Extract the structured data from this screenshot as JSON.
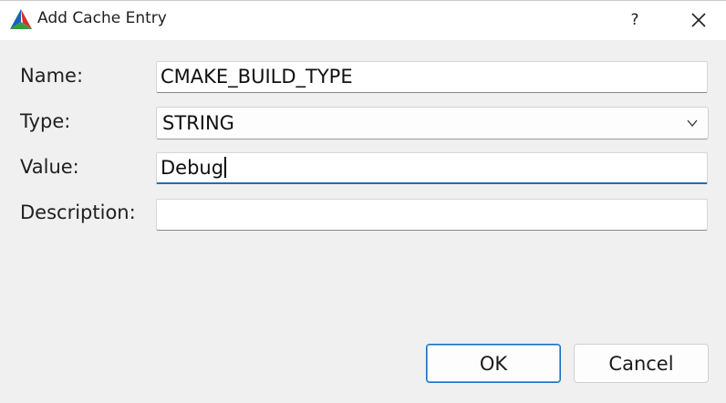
{
  "window": {
    "title": "Add Cache Entry",
    "help_label": "?",
    "app_icon": "cmake-logo-icon",
    "close_icon": "close-icon"
  },
  "form": {
    "name_label": "Name:",
    "name_value": "CMAKE_BUILD_TYPE",
    "type_label": "Type:",
    "type_value": "STRING",
    "value_label": "Value:",
    "value_value": "Debug",
    "description_label": "Description:",
    "description_value": ""
  },
  "buttons": {
    "ok_label": "OK",
    "cancel_label": "Cancel"
  },
  "colors": {
    "accent": "#1a6fc0",
    "dialog_background": "#f0f0f0",
    "titlebar_background": "#ffffff"
  }
}
